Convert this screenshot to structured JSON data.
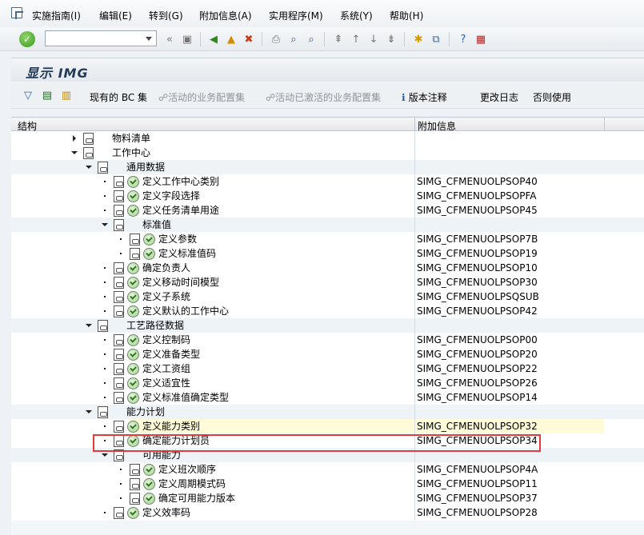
{
  "menu": {
    "items": [
      {
        "label": "实施指南(I)"
      },
      {
        "label": "编辑(E)"
      },
      {
        "label": "转到(G)"
      },
      {
        "label": "附加信息(A)"
      },
      {
        "label": "实用程序(M)"
      },
      {
        "label": "系统(Y)"
      },
      {
        "label": "帮助(H)"
      }
    ]
  },
  "toolbar": {
    "command_value": ""
  },
  "title": {
    "text": "显示 IMG"
  },
  "app_toolbar": {
    "bc_set": "现有的 BC 集",
    "active_bc": "活动的业务配置集",
    "activated_bc": "活动已激活的业务配置集",
    "release_notes": "版本注释",
    "change_log": "更改日志",
    "whether_used": "否则使用"
  },
  "tree": {
    "header_structure": "结构",
    "header_info": "附加信息",
    "rows": [
      {
        "label": "物料清单",
        "info": ""
      },
      {
        "label": "工作中心",
        "info": ""
      },
      {
        "label": "通用数据",
        "info": ""
      },
      {
        "label": "定义工作中心类别",
        "info": "SIMG_CFMENUOLPSOP40"
      },
      {
        "label": "定义字段选择",
        "info": "SIMG_CFMENUOLPSOPFA"
      },
      {
        "label": "定义任务清单用途",
        "info": "SIMG_CFMENUOLPSOP45"
      },
      {
        "label": "标准值",
        "info": ""
      },
      {
        "label": "定义参数",
        "info": "SIMG_CFMENUOLPSOP7B"
      },
      {
        "label": "定义标准值码",
        "info": "SIMG_CFMENUOLPSOP19"
      },
      {
        "label": "确定负责人",
        "info": "SIMG_CFMENUOLPSOP10"
      },
      {
        "label": "定义移动时间模型",
        "info": "SIMG_CFMENUOLPSOP30"
      },
      {
        "label": "定义子系统",
        "info": "SIMG_CFMENUOLPSQSUB"
      },
      {
        "label": "定义默认的工作中心",
        "info": "SIMG_CFMENUOLPSOP42"
      },
      {
        "label": "工艺路径数据",
        "info": ""
      },
      {
        "label": "定义控制码",
        "info": "SIMG_CFMENUOLPSOP00"
      },
      {
        "label": "定义准备类型",
        "info": "SIMG_CFMENUOLPSOP20"
      },
      {
        "label": "定义工资组",
        "info": "SIMG_CFMENUOLPSOP22"
      },
      {
        "label": "定义适宜性",
        "info": "SIMG_CFMENUOLPSOP26"
      },
      {
        "label": "定义标准值确定类型",
        "info": "SIMG_CFMENUOLPSOP14"
      },
      {
        "label": "能力计划",
        "info": ""
      },
      {
        "label": "定义能力类别",
        "info": "SIMG_CFMENUOLPSOP32"
      },
      {
        "label": "确定能力计划员",
        "info": "SIMG_CFMENUOLPSOP34"
      },
      {
        "label": "可用能力",
        "info": ""
      },
      {
        "label": "定义班次顺序",
        "info": "SIMG_CFMENUOLPSOP4A"
      },
      {
        "label": "定义周期模式码",
        "info": "SIMG_CFMENUOLPSOP11"
      },
      {
        "label": "确定可用能力版本",
        "info": "SIMG_CFMENUOLPSOP37"
      },
      {
        "label": "定义效率码",
        "info": "SIMG_CFMENUOLPSOP28"
      }
    ]
  }
}
